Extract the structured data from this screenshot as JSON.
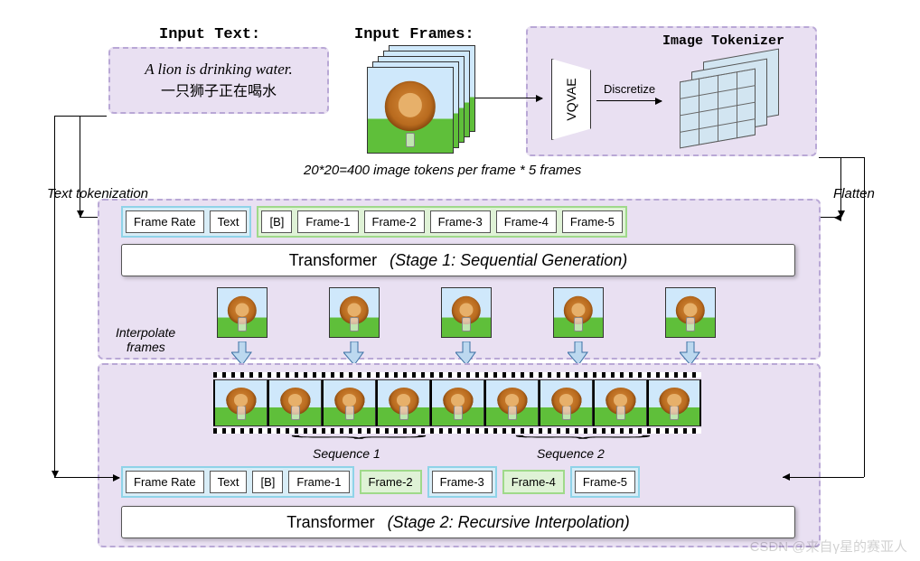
{
  "header": {
    "input_text_label": "Input Text:",
    "input_text_en": "A lion is drinking water.",
    "input_text_zh": "一只狮子正在喝水",
    "input_frames_label": "Input Frames:",
    "image_tokenizer_label": "Image Tokenizer",
    "vqvae_label": "VQVAE",
    "discretize_label": "Discretize"
  },
  "annotations": {
    "tokens_per_frame": "20*20=400 image tokens per frame  *  5 frames",
    "text_tokenization": "Text tokenization",
    "flatten": "Flatten",
    "interpolate_frames_l1": "Interpolate",
    "interpolate_frames_l2": "frames",
    "sequence1": "Sequence 1",
    "sequence2": "Sequence 2"
  },
  "tokens": {
    "frame_rate": "Frame Rate",
    "text": "Text",
    "B": "[B]",
    "f1": "Frame-1",
    "f2": "Frame-2",
    "f3": "Frame-3",
    "f4": "Frame-4",
    "f5": "Frame-5"
  },
  "transformer": {
    "title": "Transformer",
    "stage1": "(Stage 1: Sequential Generation)",
    "stage2": "(Stage 2: Recursive Interpolation)"
  },
  "watermark": "CSDN @来自γ星的赛亚人"
}
